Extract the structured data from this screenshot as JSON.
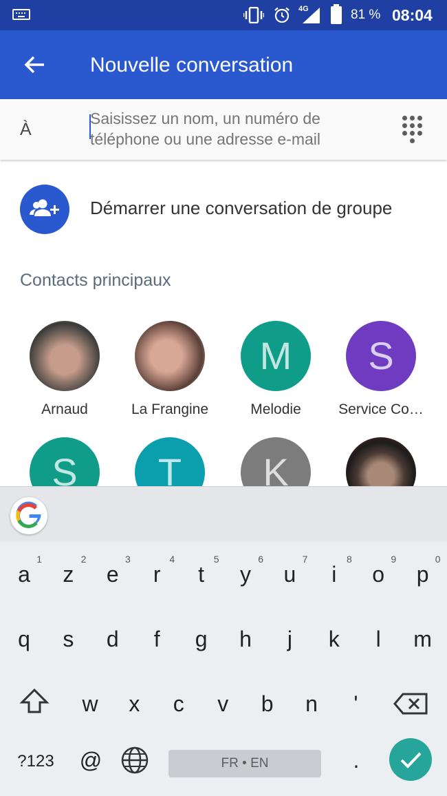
{
  "status_bar": {
    "network": "4G",
    "battery": "81 %",
    "time": "08:04",
    "icons": [
      "keyboard-icon",
      "vibrate-icon",
      "alarm-icon",
      "signal-icon",
      "battery-icon"
    ]
  },
  "app_bar": {
    "title": "Nouvelle conversation",
    "background": "#2a58cf"
  },
  "recipient": {
    "to_label": "À",
    "placeholder": "Saisissez un nom, un numéro de téléphone ou une adresse e-mail"
  },
  "group": {
    "label": "Démarrer une conversation de groupe"
  },
  "contacts_section": {
    "title": "Contacts principaux"
  },
  "contacts": [
    {
      "name": "Arnaud",
      "initial": "",
      "photo": true
    },
    {
      "name": "La Frangine",
      "initial": "",
      "photo": true
    },
    {
      "name": "Melodie",
      "initial": "M",
      "color": "#0f9d8a"
    },
    {
      "name": "Service Co…",
      "initial": "S",
      "color": "#6f3cc1"
    },
    {
      "name": "",
      "initial": "S",
      "color": "#0f9d8a"
    },
    {
      "name": "",
      "initial": "T",
      "color": "#0b9fae"
    },
    {
      "name": "",
      "initial": "K",
      "color": "#7c7c7c"
    },
    {
      "name": "",
      "initial": "",
      "photo": true
    }
  ],
  "keyboard": {
    "row1": [
      {
        "ch": "a",
        "hint": "1"
      },
      {
        "ch": "z",
        "hint": "2"
      },
      {
        "ch": "e",
        "hint": "3"
      },
      {
        "ch": "r",
        "hint": "4"
      },
      {
        "ch": "t",
        "hint": "5"
      },
      {
        "ch": "y",
        "hint": "6"
      },
      {
        "ch": "u",
        "hint": "7"
      },
      {
        "ch": "i",
        "hint": "8"
      },
      {
        "ch": "o",
        "hint": "9"
      },
      {
        "ch": "p",
        "hint": "0"
      }
    ],
    "row2": [
      "q",
      "s",
      "d",
      "f",
      "g",
      "h",
      "j",
      "k",
      "l",
      "m"
    ],
    "row3": [
      "w",
      "x",
      "c",
      "v",
      "b",
      "n",
      "'"
    ],
    "symbols": "?123",
    "at": "@",
    "space": "FR • EN",
    "period": ".",
    "enter_color": "#26a69a"
  }
}
